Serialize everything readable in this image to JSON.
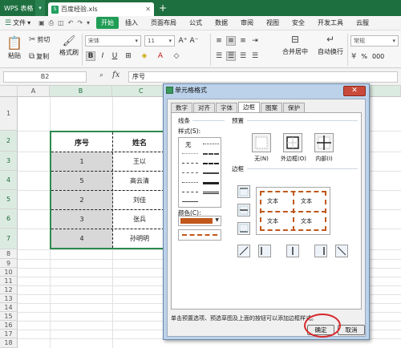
{
  "titlebar": {
    "app_title": "WPS 表格",
    "doc_tab": "百度经验.xls",
    "new_tab": "+"
  },
  "menubar": {
    "file": "文件",
    "start": "开始",
    "items": [
      "插入",
      "页面布局",
      "公式",
      "数据",
      "审阅",
      "视图",
      "安全",
      "开发工具",
      "云服"
    ]
  },
  "ribbon": {
    "paste": "粘贴",
    "cut": "剪切",
    "copy": "复制",
    "format_painter": "格式刷",
    "font_name": "宋体",
    "font_size": "11",
    "merge_center": "合并居中",
    "auto_wrap": "自动换行",
    "number_format": "常规",
    "percent": "%",
    "thousands": "000"
  },
  "formula_bar": {
    "name_box": "B2",
    "fx": "fx",
    "value": "序号"
  },
  "sheet": {
    "columns": [
      "A",
      "B",
      "C"
    ],
    "rows": [
      "1",
      "2",
      "3",
      "4",
      "5",
      "6",
      "7",
      "8",
      "9",
      "10",
      "11",
      "12",
      "13",
      "14",
      "15",
      "16",
      "17",
      "18"
    ]
  },
  "table": {
    "headers": [
      "序号",
      "姓名"
    ],
    "rows": [
      [
        "1",
        "王以"
      ],
      [
        "5",
        "高云清"
      ],
      [
        "2",
        "刘佳"
      ],
      [
        "3",
        "张兵"
      ],
      [
        "4",
        "孙明明"
      ]
    ]
  },
  "dialog": {
    "title": "单元格格式",
    "close": "✕",
    "tabs": [
      "数字",
      "对齐",
      "字体",
      "边框",
      "图案",
      "保护"
    ],
    "active_tab": "边框",
    "line_group": "线条",
    "style_label": "样式(S):",
    "style_none": "无",
    "preset_group": "预置",
    "preset_none": "无(N)",
    "preset_outline": "外边框(O)",
    "preset_inside": "内部(I)",
    "border_group": "边框",
    "color_label": "颜色(C):",
    "line_color": "#c0571b",
    "preview_text": [
      "文本",
      "文本",
      "文本",
      "文本"
    ],
    "hint": "单击预置选项、预选草图及上面的按钮可以添加边框样式。",
    "ok": "确定",
    "cancel": "取消"
  }
}
